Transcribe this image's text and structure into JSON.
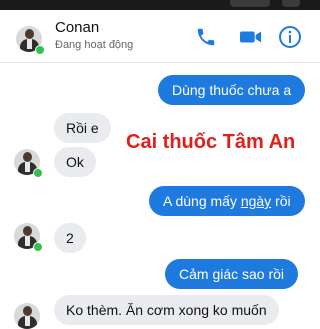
{
  "header": {
    "name": "Conan",
    "status": "Đang hoạt động"
  },
  "colors": {
    "accent": "#1f7ae0",
    "online": "#31c24d",
    "watermark": "#e0201a"
  },
  "icons": [
    "phone-icon",
    "video-call-icon",
    "info-icon"
  ],
  "watermark": "Cai thuốc Tâm An",
  "messages": [
    {
      "from": "me",
      "text": "Dùng thuốc chưa a"
    },
    {
      "from": "contact",
      "text": "Rồi e"
    },
    {
      "from": "contact",
      "text": "Ok"
    },
    {
      "from": "me",
      "text_before": "A dùng mấy ",
      "text_link": "ngày",
      "text_after": " rồi"
    },
    {
      "from": "contact",
      "text": "2"
    },
    {
      "from": "me",
      "text": "Cảm giác sao rồi"
    },
    {
      "from": "contact",
      "text": "Ko thèm. Ăn cơm xong ko muốn"
    }
  ]
}
